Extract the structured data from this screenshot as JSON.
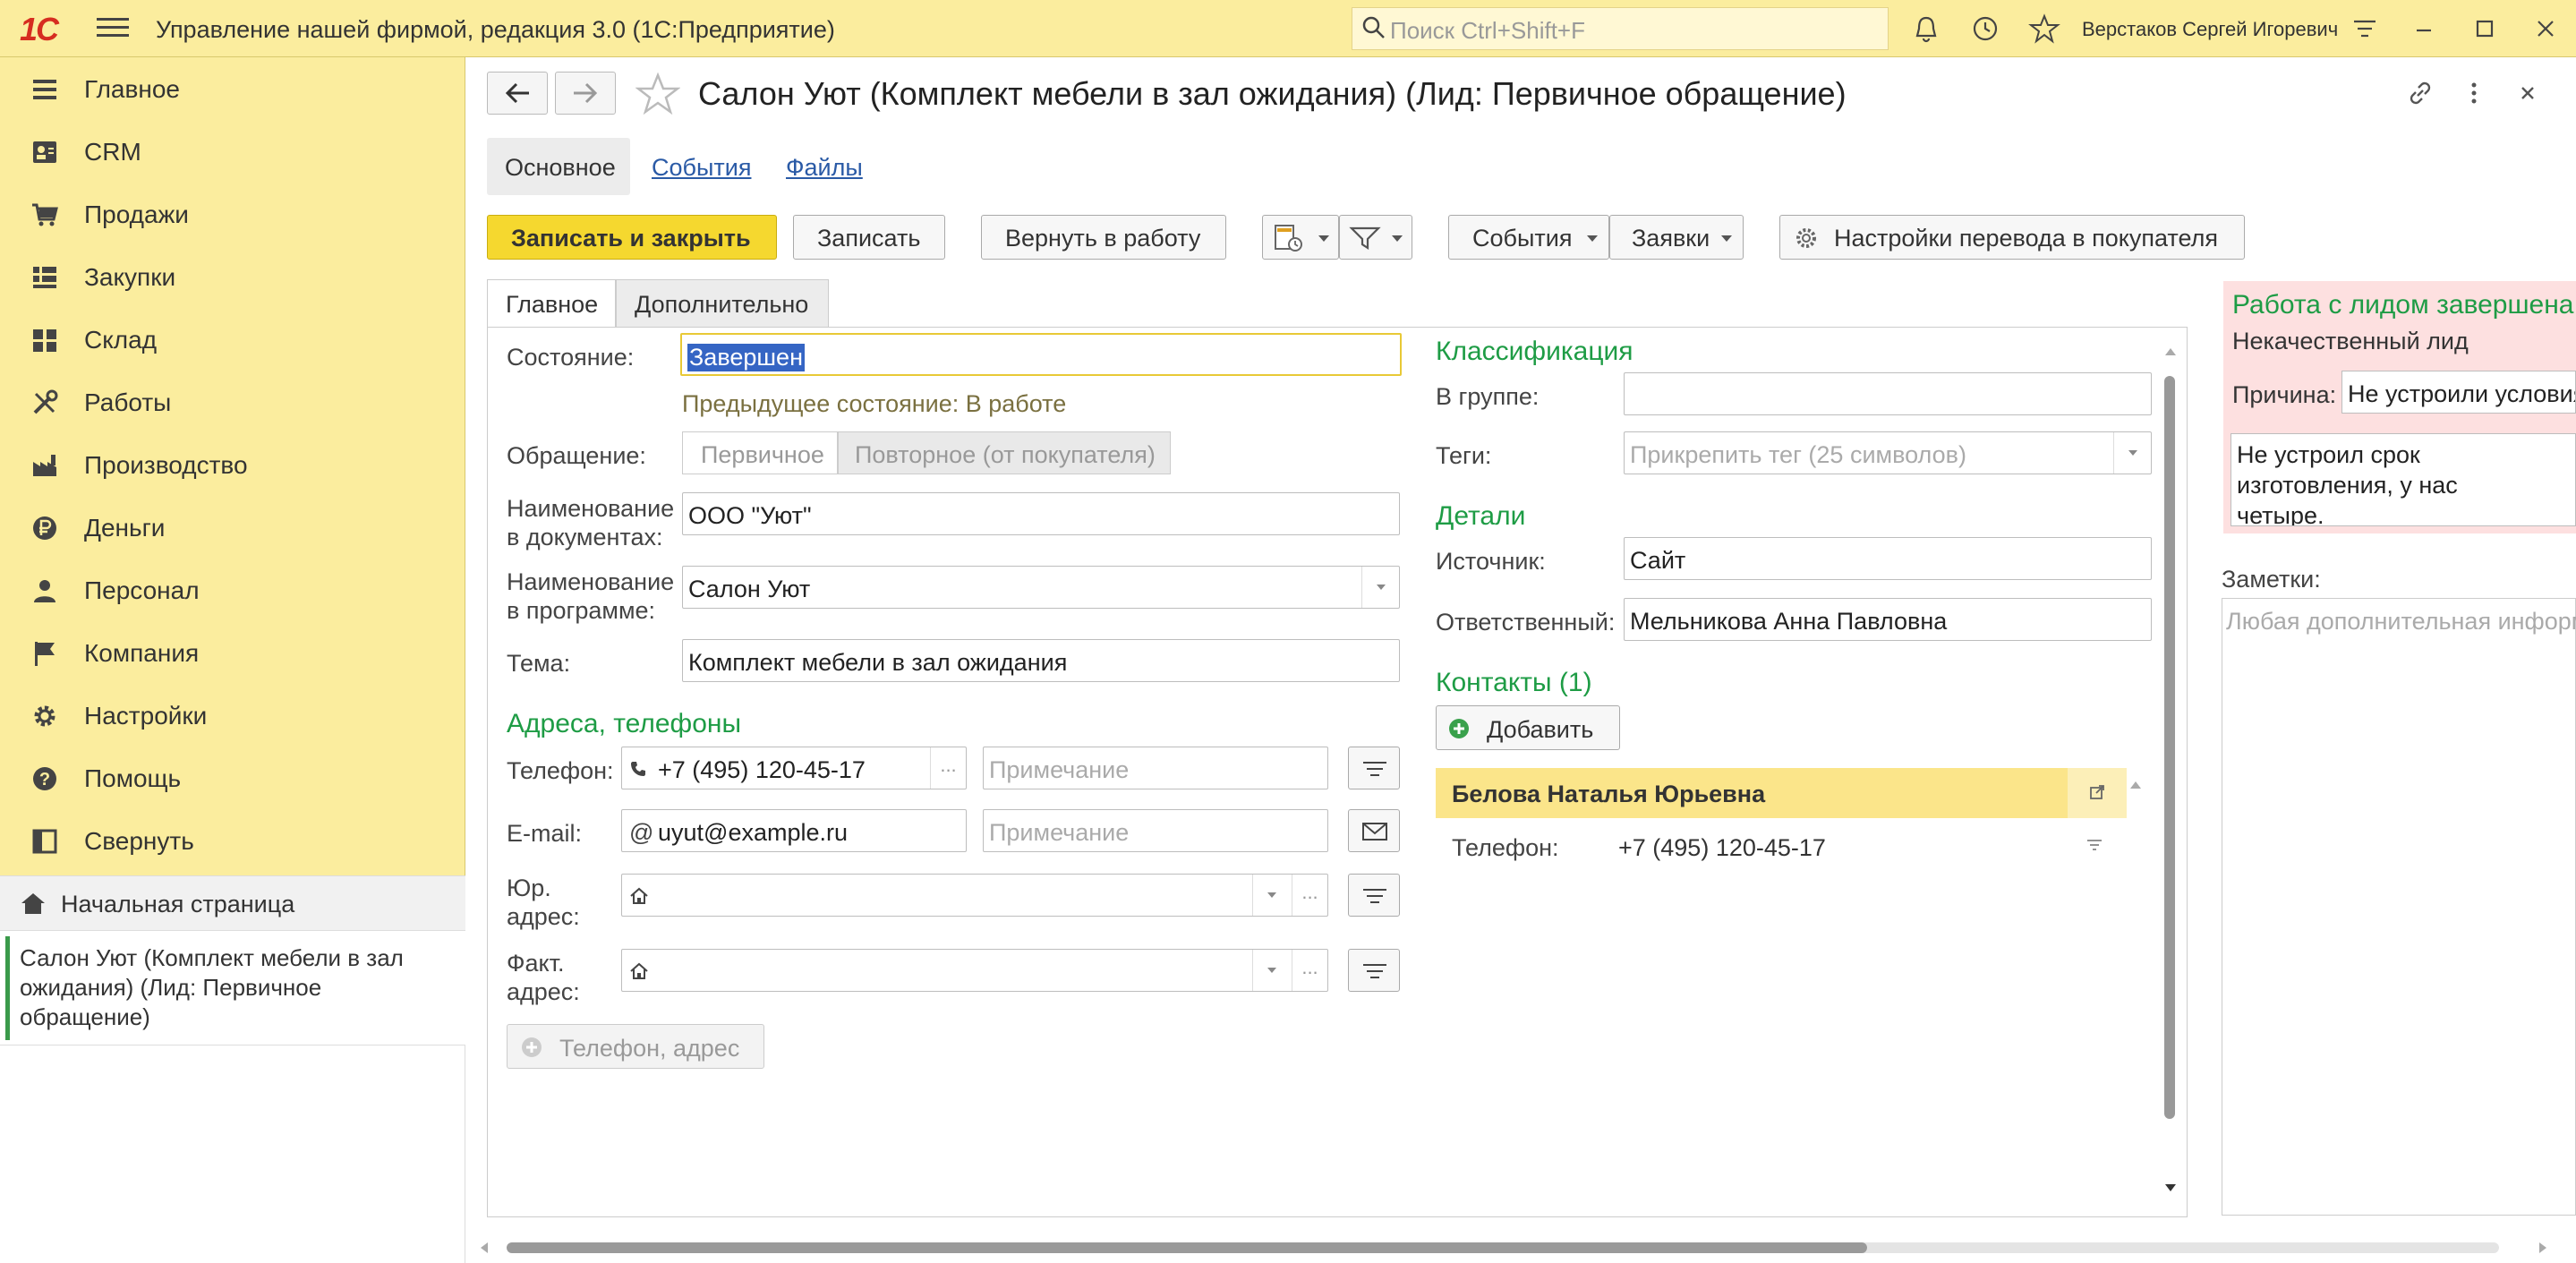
{
  "app": {
    "title": "Управление нашей фирмой, редакция 3.0  (1С:Предприятие)",
    "search_placeholder": "Поиск Ctrl+Shift+F",
    "user": "Верстаков Сергей Игоревич"
  },
  "sidebar": {
    "items": [
      {
        "label": "Главное",
        "icon": "list-icon"
      },
      {
        "label": "CRM",
        "icon": "contacts-icon"
      },
      {
        "label": "Продажи",
        "icon": "cart-icon"
      },
      {
        "label": "Закупки",
        "icon": "purchases-icon"
      },
      {
        "label": "Склад",
        "icon": "warehouse-icon"
      },
      {
        "label": "Работы",
        "icon": "tools-icon"
      },
      {
        "label": "Производство",
        "icon": "factory-icon"
      },
      {
        "label": "Деньги",
        "icon": "ruble-icon"
      },
      {
        "label": "Персонал",
        "icon": "person-icon"
      },
      {
        "label": "Компания",
        "icon": "flag-icon"
      },
      {
        "label": "Настройки",
        "icon": "gear-icon"
      },
      {
        "label": "Помощь",
        "icon": "help-icon"
      },
      {
        "label": "Свернуть",
        "icon": "collapse-icon"
      }
    ],
    "home": "Начальная страница",
    "open_document": "Салон Уют (Комплект мебели в зал ожидания) (Лид: Первичное обращение)"
  },
  "document": {
    "title": "Салон Уют (Комплект мебели в зал ожидания) (Лид: Первичное обращение)",
    "tabs": {
      "main": "Основное",
      "events": "События",
      "files": "Файлы"
    },
    "toolbar": {
      "save_close": "Записать и закрыть",
      "save": "Записать",
      "return": "Вернуть в работу",
      "events": "События",
      "requests": "Заявки",
      "conversion_settings": "Настройки перевода в покупателя"
    },
    "inner_tabs": {
      "main": "Главное",
      "extra": "Дополнительно"
    }
  },
  "form": {
    "state_label": "Состояние:",
    "state_value": "Завершен",
    "prev_state": "Предыдущее состояние: В работе",
    "appeal_label": "Обращение:",
    "appeal_primary": "Первичное",
    "appeal_repeat": "Повторное (от покупателя)",
    "docname_label_1": "Наименование",
    "docname_label_2": "в документах:",
    "docname_value": "ООО \"Уют\"",
    "progname_label_1": "Наименование",
    "progname_label_2": "в программе:",
    "progname_value": "Салон Уют",
    "topic_label": "Тема:",
    "topic_value": "Комплект мебели в зал ожидания",
    "addresses_section": "Адреса, телефоны",
    "phone_label": "Телефон:",
    "phone_value": "+7 (495) 120-45-17",
    "note_placeholder": "Примечание",
    "email_label": "E-mail:",
    "email_value": "uyut@example.ru",
    "legal_label_1": "Юр.",
    "legal_label_2": "адрес:",
    "fact_label_1": "Факт.",
    "fact_label_2": "адрес:",
    "add_phone_address": "Телефон, адрес",
    "classification_section": "Классификация",
    "group_label": "В группе:",
    "tags_label": "Теги:",
    "tags_placeholder": "Прикрепить тег (25 символов)",
    "details_section": "Детали",
    "source_label": "Источник:",
    "source_value": "Сайт",
    "responsible_label": "Ответственный:",
    "responsible_value": "Мельникова Анна Павловна",
    "contacts_section": "Контакты (1)",
    "add_button": "Добавить",
    "contact_name": "Белова Наталья Юрьевна",
    "contact_phone_label": "Телефон:",
    "contact_phone_value": "+7 (495) 120-45-17"
  },
  "lead_panel": {
    "header": "Работа с лидом завершена",
    "subtitle": "Некачественный лид",
    "reason_label": "Причина:",
    "reason_value": "Не устроили условия",
    "comment": "Не устроил срок изготовления, у нас четыре.",
    "notes_label": "Заметки:",
    "notes_placeholder": "Любая дополнительная информация"
  },
  "colors": {
    "accent_yellow": "#FBED9E",
    "section_green": "#1e9c45",
    "link_blue": "#2a5aa6",
    "primary_button": "#f5d82f"
  }
}
